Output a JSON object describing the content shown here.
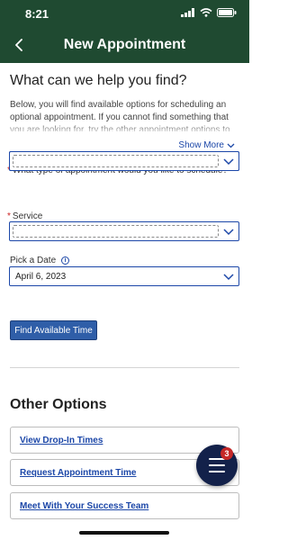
{
  "status": {
    "time": "8:21"
  },
  "nav": {
    "title": "New Appointment"
  },
  "main": {
    "heading": "What can we help you find?",
    "description": "Below, you will find available options for scheduling an optional appointment. If you cannot find something that you are looking for, try the other appointment options to see",
    "show_more": "Show More",
    "fields": {
      "appointment_type": {
        "label": "What type of appointment would you like to schedule?",
        "required_marker": "*",
        "value": ""
      },
      "service": {
        "label": "Service",
        "required_marker": "*",
        "value": ""
      },
      "date": {
        "label": "Pick a Date",
        "value": "April 6, 2023"
      }
    },
    "find_button": "Find Available Time"
  },
  "other": {
    "heading": "Other Options",
    "links": [
      "View Drop-In Times",
      "Request Appointment Time",
      "Meet With Your Success Team"
    ]
  },
  "fab": {
    "badge": "3",
    "icon": "menu-icon"
  },
  "colors": {
    "header_bg": "#1f4a31",
    "link": "#1c47a8",
    "button": "#2f5ea8",
    "fab": "#13214a",
    "badge": "#c62828",
    "required": "#cc2222"
  }
}
